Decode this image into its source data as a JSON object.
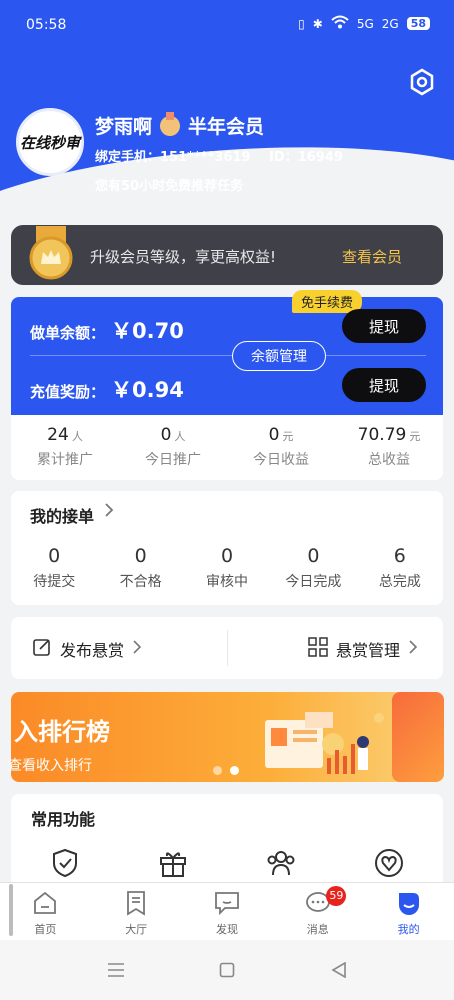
{
  "status_bar": {
    "time": "05:58",
    "battery": "58",
    "signals": [
      "5G",
      "2G"
    ]
  },
  "profile": {
    "name": "梦雨啊",
    "membership": "半年会员",
    "avatar_text": "在线秒审",
    "phone_label": "绑定手机：",
    "phone": "151****3619",
    "id_label": "ID：",
    "id": "16949",
    "free_hours_text": "您有50小时免费推荐任务"
  },
  "vip_banner": {
    "text": "升级会员等级，享更高权益!",
    "link": "查看会员"
  },
  "balance": {
    "renew_badge": "免手续费",
    "order_label": "做单余额：",
    "order_value": "￥0.70",
    "recharge_label": "充值奖励：",
    "recharge_value": "￥0.94",
    "withdraw_label": "提现",
    "manage_label": "余额管理"
  },
  "stats": [
    {
      "value": "24",
      "unit": "人",
      "label": "累计推广"
    },
    {
      "value": "0",
      "unit": "人",
      "label": "今日推广"
    },
    {
      "value": "0",
      "unit": "元",
      "label": "今日收益"
    },
    {
      "value": "70.79",
      "unit": "元",
      "label": "总收益"
    }
  ],
  "orders": {
    "title": "我的接单",
    "items": [
      {
        "value": "0",
        "label": "待提交"
      },
      {
        "value": "0",
        "label": "不合格"
      },
      {
        "value": "0",
        "label": "审核中"
      },
      {
        "value": "0",
        "label": "今日完成"
      },
      {
        "value": "6",
        "label": "总完成"
      }
    ]
  },
  "publish": {
    "left_label": "发布悬赏",
    "right_label": "悬赏管理"
  },
  "banner": {
    "title": "入排行榜",
    "subtitle": "查看收入排行"
  },
  "common": {
    "title": "常用功能",
    "icons": [
      "shield-check-icon",
      "gift-icon",
      "team-icon",
      "heart-icon"
    ]
  },
  "tabs": [
    {
      "label": "首页",
      "icon": "home-icon"
    },
    {
      "label": "大厅",
      "icon": "bookmark-icon"
    },
    {
      "label": "发现",
      "icon": "chat-square-icon"
    },
    {
      "label": "消息",
      "icon": "message-icon",
      "badge": "59"
    },
    {
      "label": "我的",
      "icon": "profile-icon",
      "active": true
    }
  ],
  "colors": {
    "primary": "#2b57f0",
    "accent_gold": "#f4c34a",
    "badge_yellow": "#f8d12f",
    "badge_red": "#e8231e"
  }
}
